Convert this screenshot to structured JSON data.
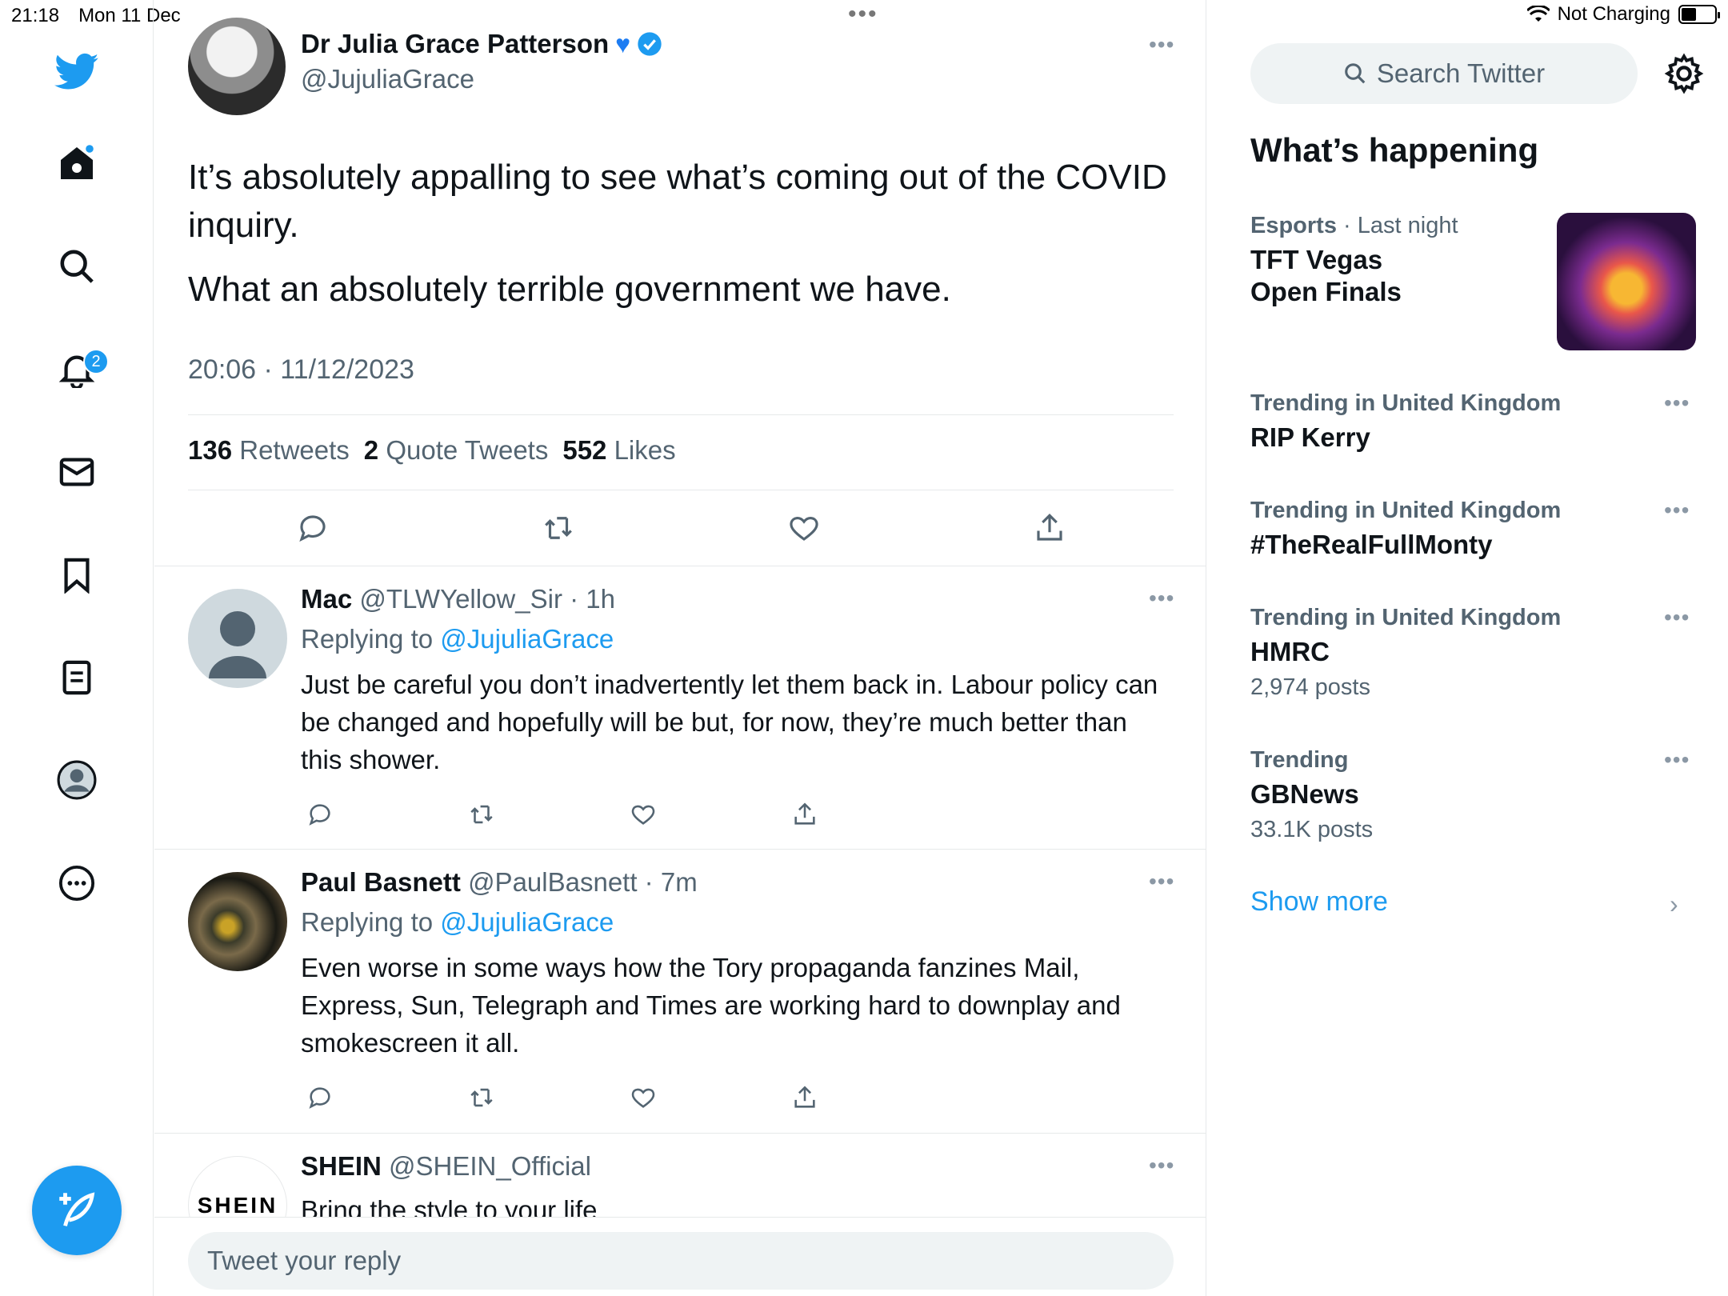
{
  "status_bar": {
    "time": "21:18",
    "date": "Mon 11 Dec",
    "charging": "Not Charging",
    "battery_level": 0.45
  },
  "nav": {
    "notifications_badge": "2"
  },
  "main_tweet": {
    "name": "Dr Julia Grace Patterson",
    "handle": "@JujuliaGrace",
    "text_1": "It’s absolutely appalling to see what’s coming out of the COVID inquiry.",
    "text_2": "What an absolutely terrible government we have.",
    "timestamp": "20:06 · 11/12/2023",
    "retweets_count": "136",
    "retweets_label": "Retweets",
    "quotes_count": "2",
    "quotes_label": "Quote Tweets",
    "likes_count": "552",
    "likes_label": "Likes"
  },
  "replies": [
    {
      "name": "Mac",
      "handle": "@TLWYellow_Sir · 1h",
      "replying_prefix": "Replying to",
      "replying_to": "@JujuliaGrace",
      "text": "Just be careful you don’t inadvertently let them back in. Labour policy can be changed and hopefully will be but, for now, they’re much better than this shower."
    },
    {
      "name": "Paul Basnett",
      "handle": "@PaulBasnett · 7m",
      "replying_prefix": "Replying to",
      "replying_to": "@JujuliaGrace",
      "text": "Even worse in some ways how the Tory propaganda fanzines Mail, Express, Sun, Telegraph and Times are working hard to downplay and smokescreen it all."
    },
    {
      "name": "SHEIN",
      "handle": "@SHEIN_Official",
      "avatar_text": "SHEIN",
      "text": "Bring the style to your life"
    }
  ],
  "reply_box": {
    "placeholder": "Tweet your reply"
  },
  "sidebar": {
    "search_placeholder": "Search Twitter",
    "whats_happening": "What’s happening",
    "trends": [
      {
        "category": "Esports",
        "meta": " · Last night",
        "title": "TFT Vegas\nOpen Finals",
        "count": ""
      },
      {
        "category": "Trending in United Kingdom",
        "meta": "",
        "title": "RIP Kerry",
        "count": ""
      },
      {
        "category": "Trending in United Kingdom",
        "meta": "",
        "title": "#TheRealFullMonty",
        "count": ""
      },
      {
        "category": "Trending in United Kingdom",
        "meta": "",
        "title": "HMRC",
        "count": "2,974 posts"
      },
      {
        "category": "Trending",
        "meta": "",
        "title": "GBNews",
        "count": "33.1K posts"
      }
    ],
    "show_more": "Show more"
  },
  "colors": {
    "accent": "#1d9bf0",
    "text": "#0f1419",
    "muted": "#536471",
    "border": "#e7e9ea"
  }
}
